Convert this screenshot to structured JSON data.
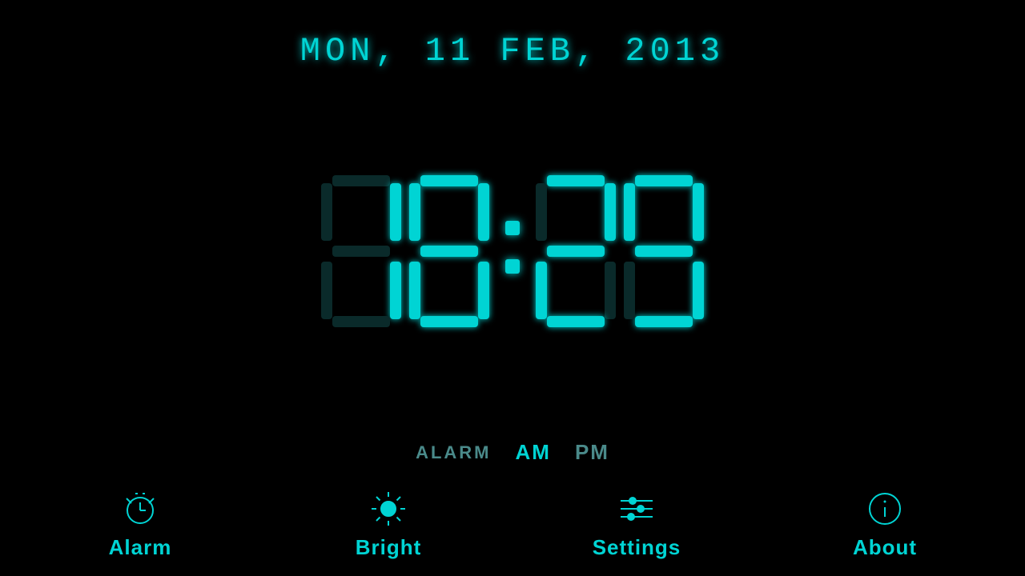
{
  "date": {
    "display": "MON,  11 FEB,  2013"
  },
  "clock": {
    "hours": "18",
    "minutes": "29",
    "ampm": {
      "am": "AM",
      "pm": "PM",
      "active": "AM"
    },
    "alarm_label": "ALARM"
  },
  "nav": {
    "items": [
      {
        "id": "alarm",
        "label": "Alarm",
        "icon": "alarm-icon"
      },
      {
        "id": "bright",
        "label": "Bright",
        "icon": "bright-icon"
      },
      {
        "id": "settings",
        "label": "Settings",
        "icon": "settings-icon"
      },
      {
        "id": "about",
        "label": "About",
        "icon": "about-icon"
      }
    ]
  },
  "colors": {
    "primary": "#00d4d4",
    "inactive": "#4a8a8a",
    "background": "#000000"
  }
}
